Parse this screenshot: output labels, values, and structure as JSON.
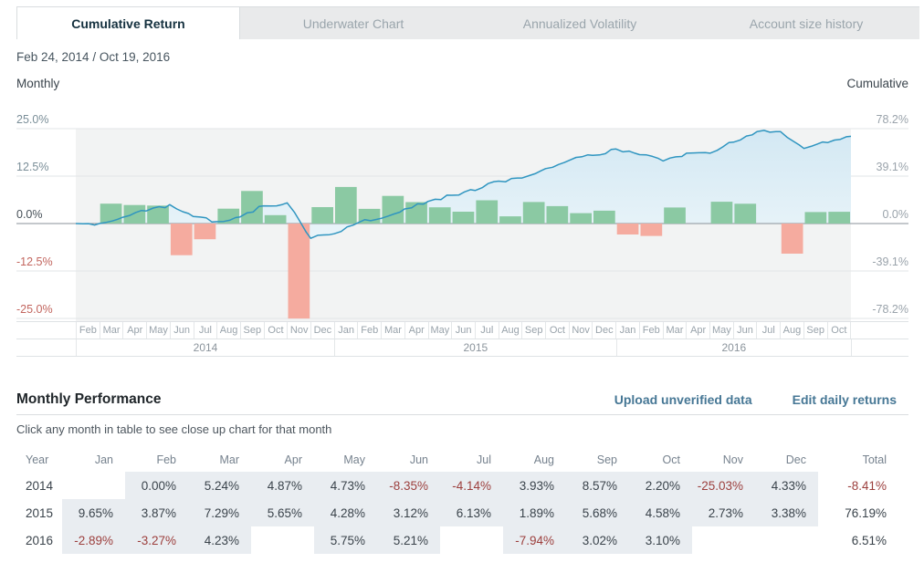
{
  "tabs": [
    {
      "label": "Cumulative Return",
      "active": true
    },
    {
      "label": "Underwater Chart",
      "active": false
    },
    {
      "label": "Annualized Volatility",
      "active": false
    },
    {
      "label": "Account size history",
      "active": false
    }
  ],
  "header": {
    "date_range": "Feb 24, 2014 / Oct 19, 2016",
    "left_series_label": "Monthly",
    "right_series_label": "Cumulative"
  },
  "chart_data": {
    "type": "combo",
    "month_labels": [
      "Feb",
      "Mar",
      "Apr",
      "May",
      "Jun",
      "Jul",
      "Aug",
      "Sep",
      "Oct",
      "Nov",
      "Dec",
      "Jan",
      "Feb",
      "Mar",
      "Apr",
      "May",
      "Jun",
      "Jul",
      "Aug",
      "Sep",
      "Oct",
      "Nov",
      "Dec",
      "Jan",
      "Feb",
      "Mar",
      "Apr",
      "May",
      "Jun",
      "Jul",
      "Aug",
      "Sep",
      "Oct"
    ],
    "year_groups": [
      {
        "label": "2014",
        "span": 11
      },
      {
        "label": "2015",
        "span": 12
      },
      {
        "label": "2016",
        "span": 10
      }
    ],
    "series": [
      {
        "name": "Monthly return",
        "type": "bar",
        "unit": "%",
        "values": [
          0.0,
          5.24,
          4.87,
          4.73,
          -8.35,
          -4.14,
          3.93,
          8.57,
          2.2,
          -25.03,
          4.33,
          9.65,
          3.87,
          7.29,
          5.65,
          4.28,
          3.12,
          6.13,
          1.89,
          5.68,
          4.58,
          2.73,
          3.38,
          -2.89,
          -3.27,
          4.23,
          null,
          5.75,
          5.21,
          null,
          -7.94,
          3.02,
          3.1
        ]
      },
      {
        "name": "Cumulative return",
        "type": "line-area",
        "unit": "%",
        "values": [
          0.0,
          5.2,
          10.4,
          15.6,
          5.9,
          1.6,
          5.5,
          14.6,
          17.1,
          -12.2,
          -8.4,
          0.5,
          4.3,
          12.0,
          18.3,
          23.3,
          27.2,
          35.0,
          37.5,
          45.3,
          52.0,
          56.2,
          61.4,
          56.8,
          51.6,
          58.0,
          58.0,
          67.1,
          75.8,
          75.8,
          61.9,
          66.7,
          71.9
        ]
      }
    ],
    "left_axis": {
      "title": "Monthly",
      "ticks": [
        "25.0%",
        "12.5%",
        "0.0%",
        "-12.5%",
        "-25.0%"
      ],
      "range": [
        -25,
        25
      ]
    },
    "right_axis": {
      "title": "Cumulative",
      "ticks": [
        "78.2%",
        "39.1%",
        "0.0%",
        "-39.1%",
        "-78.2%"
      ],
      "range": [
        -78.2,
        78.2
      ]
    },
    "grid": true,
    "legend": "none",
    "colors": {
      "bar_positive": "#8bc9a3",
      "bar_negative": "#f5ab9f",
      "line": "#2f95c0",
      "area_top": "#d3e8f3",
      "area_bottom": "#e9f4f9",
      "plot_bg": "#f2f3f3"
    }
  },
  "performance": {
    "title": "Monthly Performance",
    "subtitle": "Click any month in table to see close up chart for that month",
    "upload_link": "Upload unverified data",
    "edit_link": "Edit daily returns",
    "columns": [
      "Year",
      "Jan",
      "Feb",
      "Mar",
      "Apr",
      "May",
      "Jun",
      "Jul",
      "Aug",
      "Sep",
      "Oct",
      "Nov",
      "Dec",
      "Total"
    ],
    "rows": [
      {
        "year": "2014",
        "values": [
          "",
          "0.00%",
          "5.24%",
          "4.87%",
          "4.73%",
          "-8.35%",
          "-4.14%",
          "3.93%",
          "8.57%",
          "2.20%",
          "-25.03%",
          "4.33%"
        ],
        "total": "-8.41%"
      },
      {
        "year": "2015",
        "values": [
          "9.65%",
          "3.87%",
          "7.29%",
          "5.65%",
          "4.28%",
          "3.12%",
          "6.13%",
          "1.89%",
          "5.68%",
          "4.58%",
          "2.73%",
          "3.38%"
        ],
        "total": "76.19%"
      },
      {
        "year": "2016",
        "values": [
          "-2.89%",
          "-3.27%",
          "4.23%",
          "",
          "5.75%",
          "5.21%",
          "",
          "-7.94%",
          "3.02%",
          "3.10%",
          "",
          ""
        ],
        "total": "6.51%"
      }
    ]
  }
}
